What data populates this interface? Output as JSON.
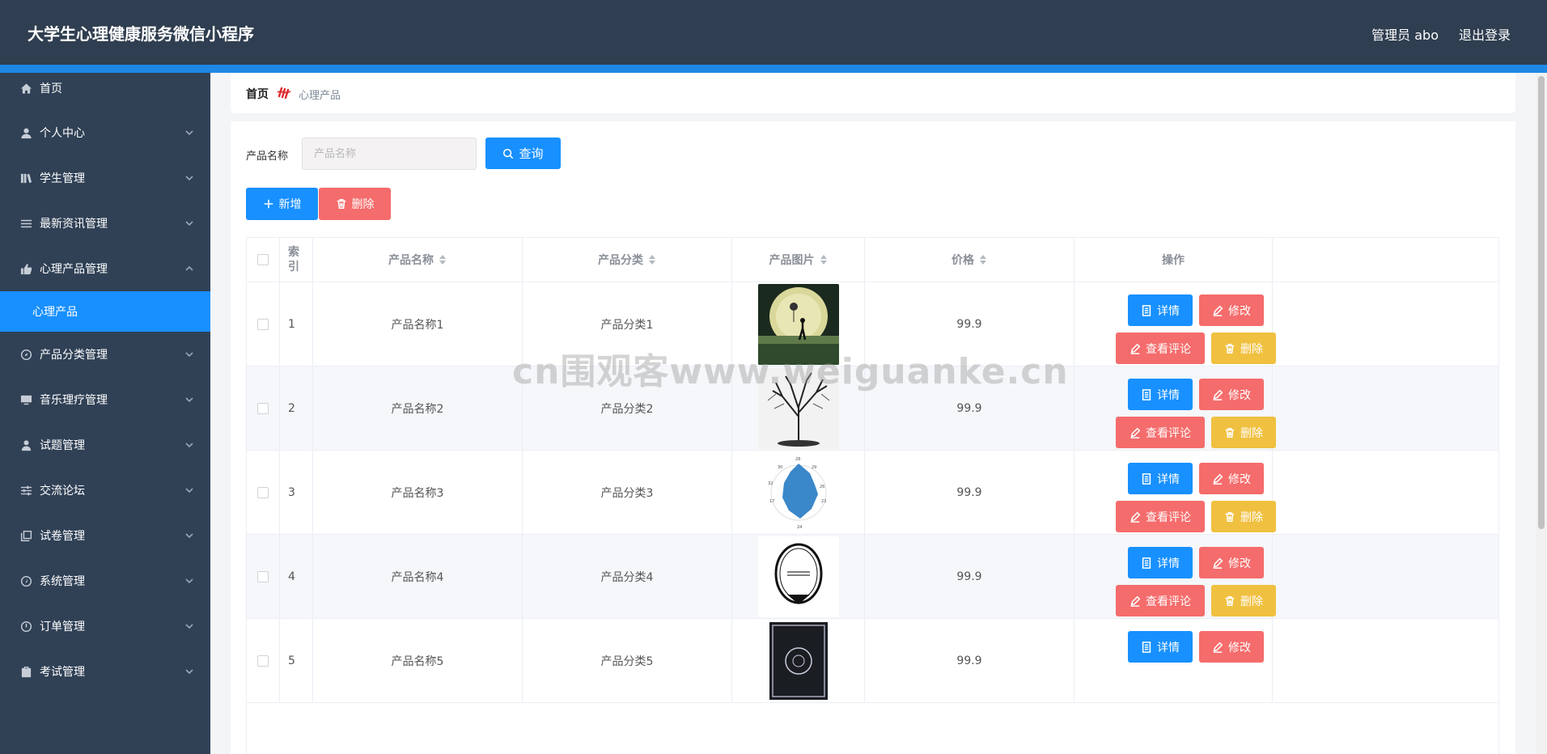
{
  "header": {
    "title": "大学生心理健康服务微信小程序",
    "user": "管理员 abo",
    "logout": "退出登录"
  },
  "sidebar": {
    "items": [
      {
        "label": "首页",
        "icon": "home-icon"
      },
      {
        "label": "个人中心",
        "icon": "user-icon"
      },
      {
        "label": "学生管理",
        "icon": "books-icon"
      },
      {
        "label": "最新资讯管理",
        "icon": "list-icon"
      },
      {
        "label": "心理产品管理",
        "icon": "product-icon"
      },
      {
        "label": "产品分类管理",
        "icon": "compass-icon"
      },
      {
        "label": "音乐理疗管理",
        "icon": "monitor-icon"
      },
      {
        "label": "试题管理",
        "icon": "person-icon"
      },
      {
        "label": "交流论坛",
        "icon": "sliders-icon"
      },
      {
        "label": "试卷管理",
        "icon": "copy-icon"
      },
      {
        "label": "系统管理",
        "icon": "gauge-icon"
      },
      {
        "label": "订单管理",
        "icon": "dial-icon"
      },
      {
        "label": "考试管理",
        "icon": "clipboard-icon"
      }
    ],
    "active_sub": "心理产品"
  },
  "breadcrumb": {
    "home": "首页",
    "current": "心理产品"
  },
  "search": {
    "label": "产品名称",
    "placeholder": "产品名称",
    "button": "查询"
  },
  "toolbar": {
    "add": "新增",
    "delete": "删除"
  },
  "table": {
    "headers": {
      "index": "索引",
      "name": "产品名称",
      "category": "产品分类",
      "image": "产品图片",
      "price": "价格",
      "actions": "操作"
    },
    "actions": {
      "detail": "详情",
      "edit": "修改",
      "comments": "查看评论",
      "delete": "删除"
    },
    "rows": [
      {
        "index": "1",
        "name": "产品名称1",
        "category": "产品分类1",
        "image": "moon-child-image",
        "price": "99.9"
      },
      {
        "index": "2",
        "name": "产品名称2",
        "category": "产品分类2",
        "image": "tree-image",
        "price": "99.9"
      },
      {
        "index": "3",
        "name": "产品名称3",
        "category": "产品分类3",
        "image": "radar-chart-image",
        "price": "99.9"
      },
      {
        "index": "4",
        "name": "产品名称4",
        "category": "产品分类4",
        "image": "test-badge-image",
        "price": "99.9"
      },
      {
        "index": "5",
        "name": "产品名称5",
        "category": "产品分类5",
        "image": "ornate-card-image",
        "price": "99.9"
      }
    ]
  },
  "watermark": "cn围观客www.weiguanke.cn",
  "colors": {
    "header": "#2f3e50",
    "accent": "#1e88e5",
    "sidebar": "#304156",
    "active": "#1890ff",
    "danger": "#f56c6c",
    "warning": "#f0c040"
  }
}
